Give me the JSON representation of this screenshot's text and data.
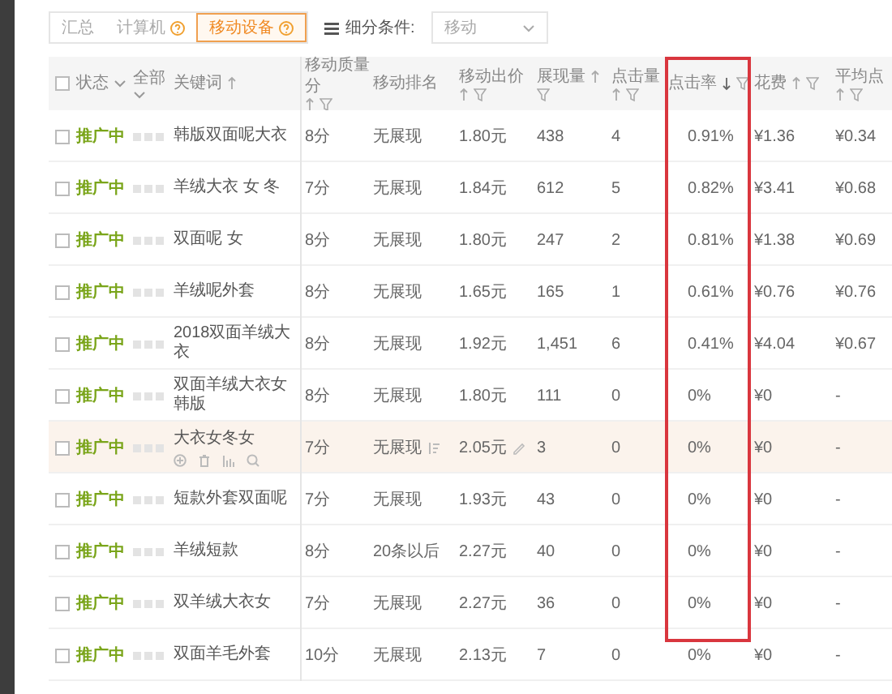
{
  "toolbar": {
    "tabs": [
      {
        "label": "汇总",
        "help": false,
        "selected": false
      },
      {
        "label": "计算机",
        "help": true,
        "selected": false
      },
      {
        "label": "移动设备",
        "help": true,
        "selected": true
      }
    ],
    "segment_label": "细分条件:",
    "segment_value": "移动"
  },
  "table": {
    "select_all_checked": false,
    "columns": [
      {
        "label": "状态",
        "menu": true,
        "sortable": false,
        "filter": false,
        "highlighted": false
      },
      {
        "label": "全部",
        "menu": true,
        "sortable": false,
        "filter": false,
        "highlighted": false
      },
      {
        "label": "关键词",
        "menu": false,
        "sortable": true,
        "descending": false,
        "filter": false,
        "highlighted": false
      },
      {
        "label": "移动质量分",
        "menu": false,
        "sortable": true,
        "descending": false,
        "filter": true,
        "highlighted": false
      },
      {
        "label": "移动排名",
        "menu": false,
        "sortable": false,
        "filter": false,
        "highlighted": false
      },
      {
        "label": "移动出价",
        "menu": false,
        "sortable": true,
        "descending": false,
        "filter": true,
        "highlighted": false
      },
      {
        "label": "展现量",
        "menu": false,
        "sortable": true,
        "descending": false,
        "filter": true,
        "highlighted": false
      },
      {
        "label": "点击量",
        "menu": false,
        "sortable": true,
        "descending": false,
        "filter": true,
        "highlighted": false
      },
      {
        "label": "点击率",
        "menu": false,
        "sortable": true,
        "descending": true,
        "filter": true,
        "highlighted": true
      },
      {
        "label": "花费",
        "menu": false,
        "sortable": true,
        "descending": false,
        "filter": true,
        "highlighted": false
      },
      {
        "label": "平均点",
        "menu": false,
        "sortable": true,
        "descending": false,
        "filter": true,
        "highlighted": false
      }
    ],
    "rows": [
      {
        "checked": false,
        "hovered": false,
        "status": "推广中",
        "keyword": "韩版双面呢大衣",
        "quality": "8分",
        "rank": "无展现",
        "bid": "1.80元",
        "impressions": "438",
        "clicks": "4",
        "ctr": "0.91%",
        "cost": "¥1.36",
        "avg_cpc": "¥0.34"
      },
      {
        "checked": false,
        "hovered": false,
        "status": "推广中",
        "keyword": "羊绒大衣 女 冬",
        "quality": "7分",
        "rank": "无展现",
        "bid": "1.84元",
        "impressions": "612",
        "clicks": "5",
        "ctr": "0.82%",
        "cost": "¥3.41",
        "avg_cpc": "¥0.68"
      },
      {
        "checked": false,
        "hovered": false,
        "status": "推广中",
        "keyword": "双面呢 女",
        "quality": "8分",
        "rank": "无展现",
        "bid": "1.80元",
        "impressions": "247",
        "clicks": "2",
        "ctr": "0.81%",
        "cost": "¥1.38",
        "avg_cpc": "¥0.69"
      },
      {
        "checked": false,
        "hovered": false,
        "status": "推广中",
        "keyword": "羊绒呢外套",
        "quality": "8分",
        "rank": "无展现",
        "bid": "1.65元",
        "impressions": "165",
        "clicks": "1",
        "ctr": "0.61%",
        "cost": "¥0.76",
        "avg_cpc": "¥0.76"
      },
      {
        "checked": false,
        "hovered": false,
        "status": "推广中",
        "keyword": "2018双面羊绒大衣",
        "quality": "8分",
        "rank": "无展现",
        "bid": "1.92元",
        "impressions": "1,451",
        "clicks": "6",
        "ctr": "0.41%",
        "cost": "¥4.04",
        "avg_cpc": "¥0.67"
      },
      {
        "checked": false,
        "hovered": false,
        "status": "推广中",
        "keyword": "双面羊绒大衣女韩版",
        "quality": "8分",
        "rank": "无展现",
        "bid": "1.80元",
        "impressions": "111",
        "clicks": "0",
        "ctr": "0%",
        "cost": "¥0",
        "avg_cpc": "-"
      },
      {
        "checked": false,
        "hovered": true,
        "status": "推广中",
        "keyword": "大衣女冬女",
        "quality": "7分",
        "rank": "无展现",
        "bid": "2.05元",
        "impressions": "3",
        "clicks": "0",
        "ctr": "0%",
        "cost": "¥0",
        "avg_cpc": "-"
      },
      {
        "checked": false,
        "hovered": false,
        "status": "推广中",
        "keyword": "短款外套双面呢",
        "quality": "7分",
        "rank": "无展现",
        "bid": "1.93元",
        "impressions": "43",
        "clicks": "0",
        "ctr": "0%",
        "cost": "¥0",
        "avg_cpc": "-"
      },
      {
        "checked": false,
        "hovered": false,
        "status": "推广中",
        "keyword": "羊绒短款",
        "quality": "8分",
        "rank": "20条以后",
        "bid": "2.27元",
        "impressions": "40",
        "clicks": "0",
        "ctr": "0%",
        "cost": "¥0",
        "avg_cpc": "-"
      },
      {
        "checked": false,
        "hovered": false,
        "status": "推广中",
        "keyword": "双羊绒大衣女",
        "quality": "7分",
        "rank": "无展现",
        "bid": "2.27元",
        "impressions": "36",
        "clicks": "0",
        "ctr": "0%",
        "cost": "¥0",
        "avg_cpc": "-"
      },
      {
        "checked": false,
        "hovered": false,
        "status": "推广中",
        "keyword": "双面羊毛外套",
        "quality": "10分",
        "rank": "无展现",
        "bid": "2.13元",
        "impressions": "7",
        "clicks": "0",
        "ctr": "0%",
        "cost": "¥0",
        "avg_cpc": "-"
      }
    ]
  }
}
